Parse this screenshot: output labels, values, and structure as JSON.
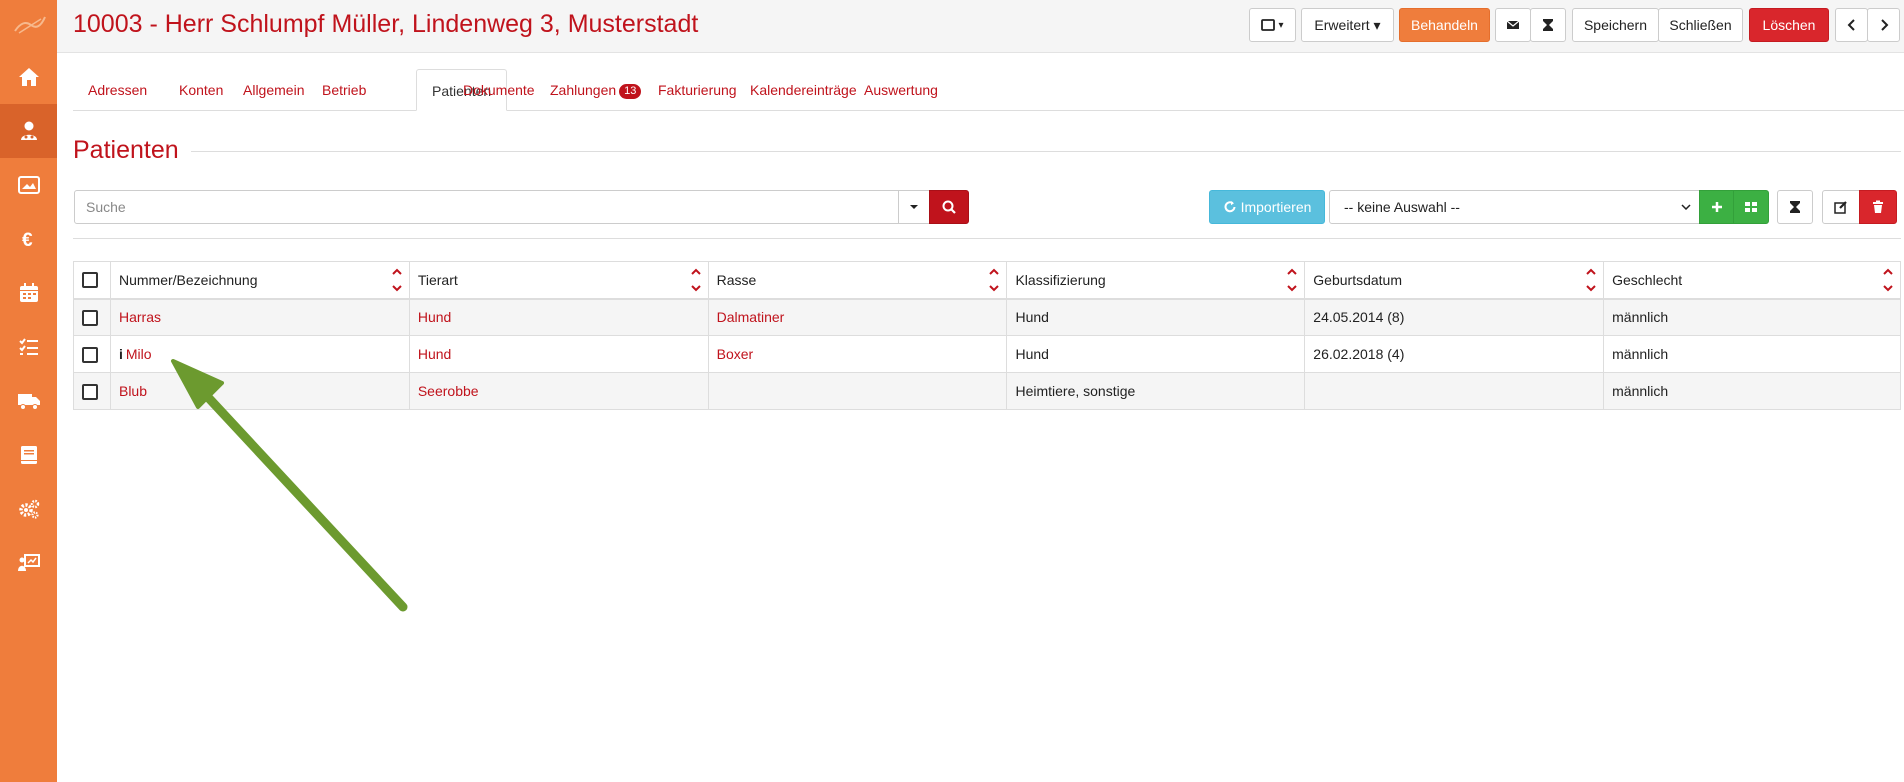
{
  "header": {
    "title": "10003 - Herr Schlumpf Müller, Lindenweg 3, Musterstadt"
  },
  "toolbar": {
    "device_label": "▾",
    "erweitert_label": "Erweitert ▾",
    "behandeln_label": "Behandeln",
    "speichern_label": "Speichern",
    "schliessen_label": "Schließen",
    "loeschen_label": "Löschen"
  },
  "sidebar": {
    "items": [
      "home-icon",
      "patients-icon",
      "image-icon",
      "euro-icon",
      "calendar-icon",
      "task-list-icon",
      "truck-icon",
      "book-icon",
      "gears-icon",
      "presentation-icon"
    ]
  },
  "tabs": [
    {
      "label": "Adressen"
    },
    {
      "label": "Konten"
    },
    {
      "label": "Allgemein"
    },
    {
      "label": "Betrieb"
    },
    {
      "label": "Patienten"
    },
    {
      "label": "Dokumente"
    },
    {
      "label": "Zahlungen",
      "badge": "13"
    },
    {
      "label": "Fakturierung"
    },
    {
      "label": "Kalendereinträge"
    },
    {
      "label": "Auswertung"
    }
  ],
  "section": {
    "title": "Patienten"
  },
  "search": {
    "placeholder": "Suche"
  },
  "actions": {
    "import_label": "Importieren",
    "select_value": "-- keine Auswahl --"
  },
  "table": {
    "columns": [
      "Nummer/Bezeichnung",
      "Tierart",
      "Rasse",
      "Klassifizierung",
      "Geburtsdatum",
      "Geschlecht"
    ],
    "rows": [
      {
        "name": "Harras",
        "tierart": "Hund",
        "rasse": "Dalmatiner",
        "klass": "Hund",
        "geburt": "24.05.2014 (8)",
        "geschlecht": "männlich"
      },
      {
        "name": "Milo",
        "tierart": "Hund",
        "rasse": "Boxer",
        "klass": "Hund",
        "geburt": "26.02.2018 (4)",
        "geschlecht": "männlich"
      },
      {
        "name": "Blub",
        "tierart": "Seerobbe",
        "rasse": "",
        "klass": "Heimtiere, sonstige",
        "geburt": "",
        "geschlecht": "männlich"
      }
    ]
  },
  "colors": {
    "brand": "#ef7d3c",
    "accent": "#c0131c",
    "import": "#5bc0de",
    "add": "#3cb043",
    "arrow": "#6c9a2f"
  }
}
